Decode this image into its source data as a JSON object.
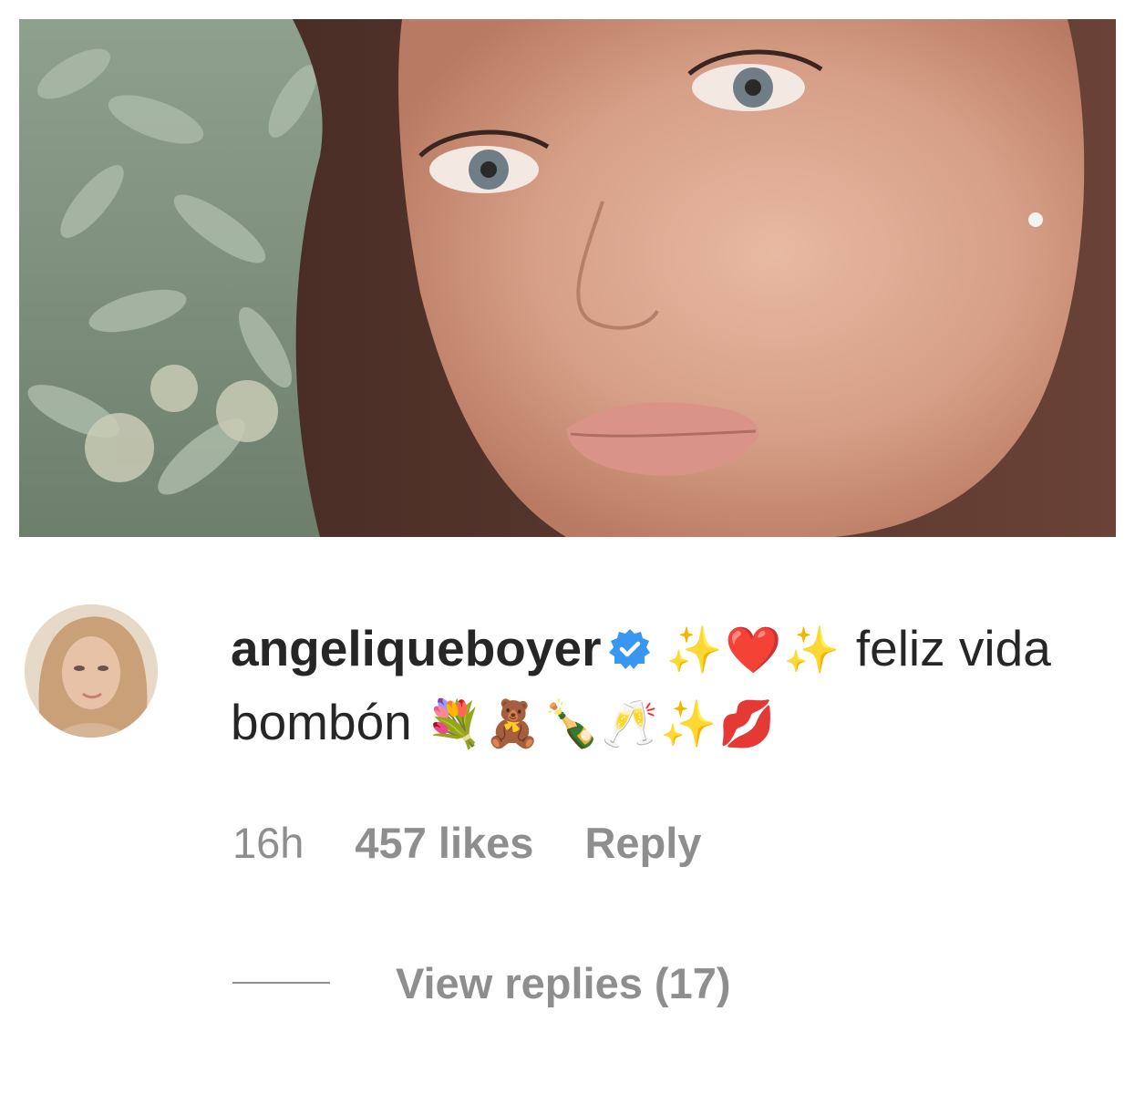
{
  "post": {
    "photo_alt": "photo-of-woman-with-plants"
  },
  "comment": {
    "username": "angeliqueboyer",
    "verified_icon": "verified-badge-icon",
    "verified_color": "#3897f0",
    "emoji_prefix": "✨❤️✨",
    "text_part1": "feliz",
    "text_part2": "vida bombón",
    "emoji_suffix": "💐🧸🍾🥂✨💋",
    "time": "16h",
    "likes": "457 likes",
    "reply_label": "Reply",
    "view_replies_label": "View replies (17)"
  },
  "colors": {
    "text_primary": "#262626",
    "text_secondary": "#8e8e8e"
  }
}
